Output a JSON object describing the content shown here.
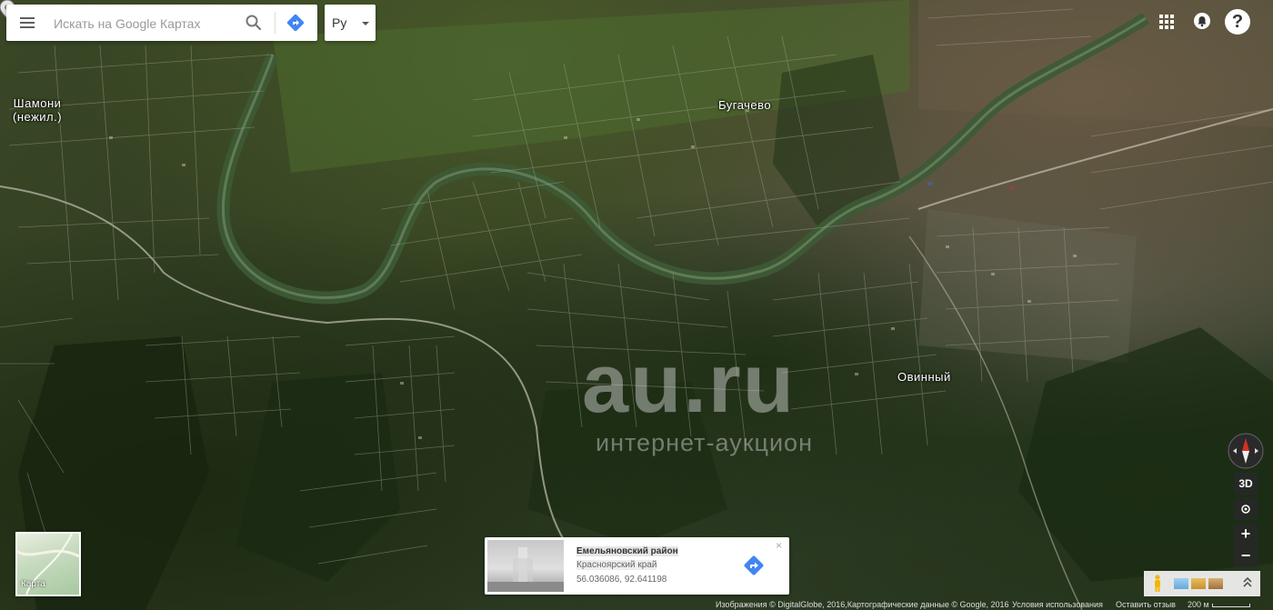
{
  "search": {
    "placeholder": "Искать на Google Картах",
    "value": ""
  },
  "language": {
    "selected": "Ру"
  },
  "labels": {
    "shamoni": "Шамони\n(нежил.)",
    "bugachevo": "Бугачево",
    "ovinny": "Овинный"
  },
  "watermark": {
    "main": "au.ru",
    "sub": "интернет-аукцион"
  },
  "controls": {
    "three_d": "3D",
    "zoom_in": "+",
    "zoom_out": "−",
    "help": "?"
  },
  "map_thumbnail": {
    "label": "Карта"
  },
  "info_card": {
    "title": "Емельяновский район",
    "region": "Красноярский край",
    "coordinates": "56.036086, 92.641198",
    "close": "×"
  },
  "footer": {
    "attribution": "Изображения © DigitalGlobe, 2016,Картографические данные © Google, 2016",
    "terms": "Условия использования",
    "feedback": "Оставить отзыв",
    "scale": "200 м"
  },
  "colors": {
    "directions_blue": "#4285f4",
    "compass_red": "#d93025"
  },
  "icons": {
    "menu": "hamburger-menu-icon",
    "search": "search-icon",
    "directions": "directions-icon",
    "apps": "apps-grid-icon",
    "notifications": "notifications-icon",
    "help": "help-icon",
    "pin": "place-pin-icon",
    "compass": "compass-icon",
    "locate": "my-location-icon",
    "pegman": "pegman-icon",
    "expand": "expand-icon"
  }
}
